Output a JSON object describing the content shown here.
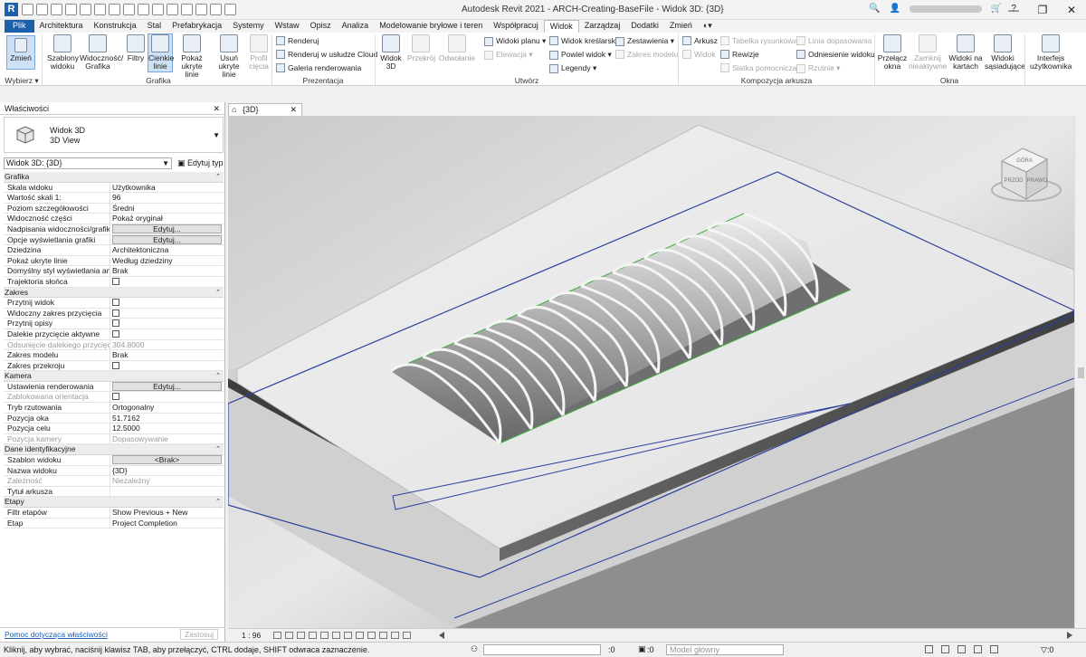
{
  "app": {
    "title": "Autodesk Revit 2021 - ARCH-Creating-BaseFile - Widok 3D: {3D}",
    "logo": "R",
    "window_controls": [
      "—",
      "❐",
      "✕"
    ]
  },
  "tabs": [
    "Plik",
    "Architektura",
    "Konstrukcja",
    "Stal",
    "Prefabrykacja",
    "Systemy",
    "Wstaw",
    "Opisz",
    "Analiza",
    "Modelowanie bryłowe i teren",
    "Współpracuj",
    "Widok",
    "Zarządzaj",
    "Dodatki",
    "Zmień"
  ],
  "active_tab": "Widok",
  "ribbon": {
    "select": {
      "label": "Zmień",
      "panel": "Wybierz ▾"
    },
    "graphics": {
      "buttons": [
        {
          "label": "Szablony widoku",
          "dd": "▾"
        },
        {
          "label": "Widoczność/ Grafika"
        },
        {
          "label": "Filtry"
        },
        {
          "label": "Cienkie linie"
        },
        {
          "label": "Pokaż ukryte linie"
        },
        {
          "label": "Usuń ukryte linie"
        },
        {
          "label": "Profil cięcia"
        }
      ],
      "panel": "Grafika"
    },
    "presentation": {
      "items": [
        "Renderuj",
        "Renderuj w usłudze Cloud",
        "Galeria renderowania"
      ],
      "panel": "Prezentacja"
    },
    "create": {
      "big": [
        {
          "label": "Widok 3D"
        },
        {
          "label": "Przekrój"
        },
        {
          "label": "Odwołanie"
        }
      ],
      "col1": [
        "Widoki planu ▾",
        "Elewacja ▾"
      ],
      "col2": [
        "Widok kreślarski",
        "Powiel widok ▾",
        "Legendy ▾"
      ],
      "col3": [
        "Zestawienia ▾",
        "Zakres modelu"
      ],
      "panel": "Utwórz"
    },
    "sheet": {
      "col1": [
        "Arkusz",
        "Widok"
      ],
      "col2": [
        "Tabelka rysunkowa",
        "Rewizje",
        "Siatka pomocnicza"
      ],
      "col3": [
        "Linia dopasowania",
        "Odniesienie widoku",
        "Rzutnie ▾"
      ],
      "panel": "Kompozycja arkusza"
    },
    "windows": {
      "buttons": [
        {
          "label": "Przełącz okna"
        },
        {
          "label": "Zamknij nieaktywne"
        },
        {
          "label": "Widoki na kartach"
        },
        {
          "label": "Widoki sąsiadujące"
        }
      ],
      "panel": "Okna"
    },
    "ui": {
      "label": "Interfejs użytkownika"
    }
  },
  "properties": {
    "title": "Właściwości",
    "type_name": "Widok 3D",
    "type_sub": "3D View",
    "instance": "Widok 3D: {3D}",
    "edit_type": "Edytuj typ",
    "groups": [
      {
        "name": "Grafika",
        "rows": [
          {
            "k": "Skala widoku",
            "v": "Użytkownika"
          },
          {
            "k": "Wartość skali   1:",
            "v": "96"
          },
          {
            "k": "Poziom szczegółowości",
            "v": "Średni"
          },
          {
            "k": "Widoczność części",
            "v": "Pokaż oryginał"
          },
          {
            "k": "Nadpisania widoczności/grafiki",
            "v": "Edytuj...",
            "btn": true
          },
          {
            "k": "Opcje wyświetlania grafiki",
            "v": "Edytuj...",
            "btn": true
          },
          {
            "k": "Dziedzina",
            "v": "Architektoniczna"
          },
          {
            "k": "Pokaż ukryte linie",
            "v": "Według dziedziny"
          },
          {
            "k": "Domyślny styl wyświetlania ana...",
            "v": "Brak"
          },
          {
            "k": "Trajektoria słońca",
            "v": "",
            "cb": true
          }
        ]
      },
      {
        "name": "Zakres",
        "rows": [
          {
            "k": "Przytnij widok",
            "v": "",
            "cb": true
          },
          {
            "k": "Widoczny zakres przycięcia",
            "v": "",
            "cb": true
          },
          {
            "k": "Przytnij opisy",
            "v": "",
            "cb": true
          },
          {
            "k": "Dalekie przycięcie aktywne",
            "v": "",
            "cb": true
          },
          {
            "k": "Odsunięcie dalekiego przycięcia",
            "v": "304.8000",
            "dim": true
          },
          {
            "k": "Zakres modelu",
            "v": "Brak"
          },
          {
            "k": "Zakres przekroju",
            "v": "",
            "cb": true
          }
        ]
      },
      {
        "name": "Kamera",
        "rows": [
          {
            "k": "Ustawienia renderowania",
            "v": "Edytuj...",
            "btn": true
          },
          {
            "k": "Zablokowana orientacja",
            "v": "",
            "cb": true,
            "dim": true
          },
          {
            "k": "Tryb rzutowania",
            "v": "Ortogonalny"
          },
          {
            "k": "Pozycja oka",
            "v": "51.7162"
          },
          {
            "k": "Pozycja celu",
            "v": "12.5000"
          },
          {
            "k": "Pozycja kamery",
            "v": "Dopasowywanie",
            "dim": true
          }
        ]
      },
      {
        "name": "Dane identyfikacyjne",
        "rows": [
          {
            "k": "Szablon widoku",
            "v": "<Brak>",
            "btn": true
          },
          {
            "k": "Nazwa widoku",
            "v": "{3D}"
          },
          {
            "k": "Zależność",
            "v": "Niezależny",
            "dim": true
          },
          {
            "k": "Tytuł arkusza",
            "v": ""
          }
        ]
      },
      {
        "name": "Etapy",
        "rows": [
          {
            "k": "Filtr etapów",
            "v": "Show Previous + New"
          },
          {
            "k": "Etap",
            "v": "Project Completion"
          }
        ]
      }
    ],
    "help": "Pomoc dotycząca właściwości",
    "apply": "Zastosuj"
  },
  "view": {
    "tab": "{3D}",
    "scale": "1 : 96",
    "viewcube": {
      "top": "GÓRA",
      "front": "PRAWO",
      "left": "PRZÓD"
    }
  },
  "status": {
    "message": "Kliknij, aby wybrać, naciśnij klawisz TAB, aby przełączyć, CTRL dodaje, SHIFT odwraca zaznaczenie.",
    "z1": ":0",
    "z2": ":0",
    "model": "Model główny",
    "filter": "▽:0"
  },
  "colors": {
    "accent": "#1d5fa8",
    "crop": "#2b3f9e",
    "glass_edge": "#3fae3f"
  }
}
